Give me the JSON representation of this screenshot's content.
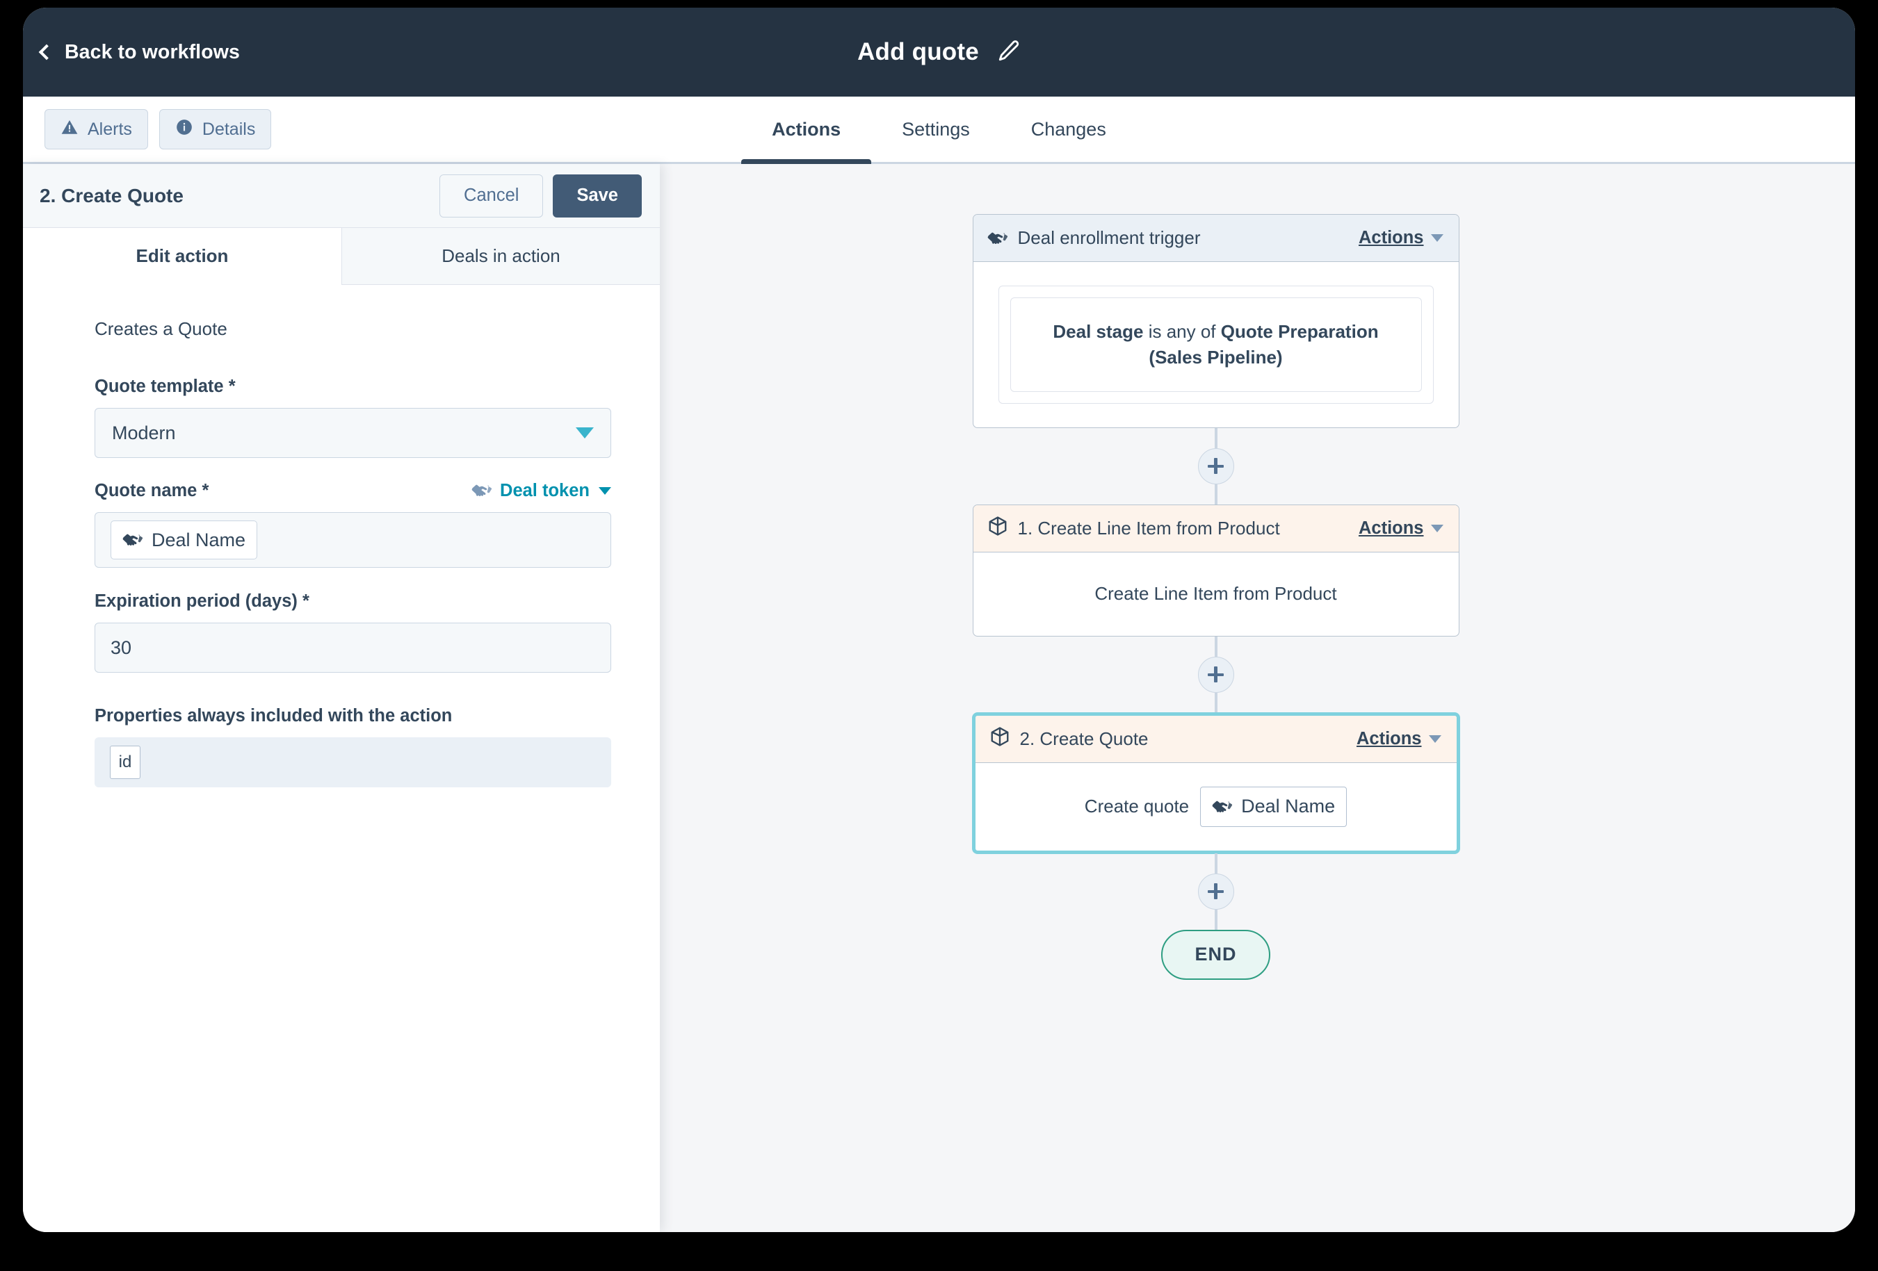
{
  "topbar": {
    "back_label": "Back to workflows",
    "title": "Add quote",
    "edit_icon": "pencil-icon",
    "back_icon": "chevron-left-icon"
  },
  "subbar": {
    "buttons": [
      {
        "label": "Alerts",
        "icon": "warning-triangle-icon"
      },
      {
        "label": "Details",
        "icon": "info-circle-icon"
      }
    ],
    "tabs": [
      {
        "label": "Actions",
        "active": true
      },
      {
        "label": "Settings",
        "active": false
      },
      {
        "label": "Changes",
        "active": false
      }
    ]
  },
  "left_panel": {
    "title": "2. Create Quote",
    "cancel_label": "Cancel",
    "save_label": "Save",
    "tabs": [
      {
        "label": "Edit action",
        "active": true
      },
      {
        "label": "Deals in action",
        "active": false
      }
    ],
    "description": "Creates a Quote",
    "fields": {
      "quote_template": {
        "label": "Quote template *",
        "value": "Modern",
        "caret_icon": "chevron-down-icon"
      },
      "quote_name": {
        "label": "Quote name *",
        "token_link": "Deal token",
        "token_link_icon": "handshake-deal-icon",
        "token_caret_icon": "chevron-down-icon",
        "chip_label": "Deal Name",
        "chip_icon": "handshake-deal-icon"
      },
      "expiration_period": {
        "label": "Expiration period (days) *",
        "value": "30"
      },
      "properties_included": {
        "label": "Properties always included with the action",
        "chips": [
          "id"
        ]
      }
    }
  },
  "canvas": {
    "nodes": [
      {
        "kind": "trigger",
        "icon": "handshake-deal-icon",
        "title": "Deal enrollment trigger",
        "actions_label": "Actions",
        "actions_caret_icon": "chevron-down-icon",
        "criteria_prefix": "Deal stage",
        "criteria_middle": " is any of ",
        "criteria_value": "Quote Preparation (Sales Pipeline)"
      },
      {
        "kind": "action",
        "icon": "cube-object-icon",
        "title": "1. Create Line Item from Product",
        "actions_label": "Actions",
        "actions_caret_icon": "chevron-down-icon",
        "body_text": "Create Line Item from Product"
      },
      {
        "kind": "action",
        "selected": true,
        "icon": "cube-object-icon",
        "title": "2. Create Quote",
        "actions_label": "Actions",
        "actions_caret_icon": "chevron-down-icon",
        "body_prefix": "Create quote",
        "body_chip_label": "Deal Name",
        "body_chip_icon": "handshake-deal-icon"
      }
    ],
    "add_step_icon": "plus-icon",
    "end_label": "END"
  },
  "colors": {
    "topbar_bg": "#253342",
    "accent_teal": "#0091ae",
    "save_btn": "#425b76",
    "selected_border": "#7fd1de",
    "end_border": "#2e9e82",
    "action_head_bg": "#fdf3eb",
    "trigger_head_bg": "#eaf0f6",
    "canvas_bg": "#f5f6f8",
    "text": "#33475b"
  }
}
